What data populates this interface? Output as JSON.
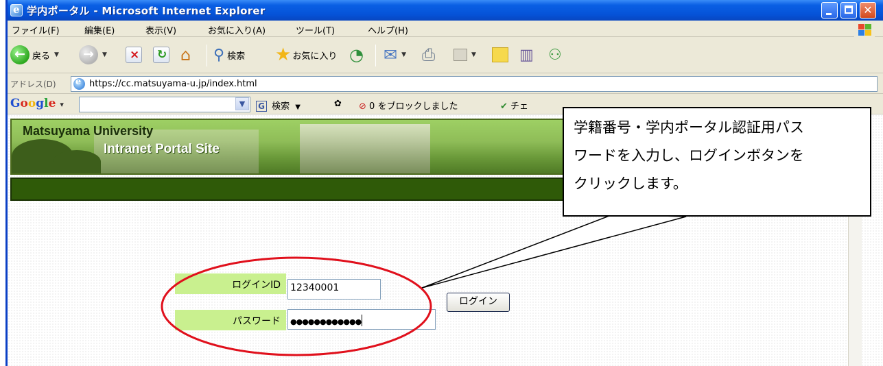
{
  "window": {
    "title": "学内ポータル - Microsoft Internet Explorer"
  },
  "menu": [
    "ファイル(F)",
    "編集(E)",
    "表示(V)",
    "お気に入り(A)",
    "ツール(T)",
    "ヘルプ(H)"
  ],
  "toolbar": {
    "back_label": "戻る",
    "search_label": "検索",
    "favorites_label": "お気に入り"
  },
  "address": {
    "label": "アドレス(D)",
    "url": "https://cc.matsuyama-u.jp/index.html"
  },
  "googlebar": {
    "logo": "Google",
    "search_label": "検索",
    "blocked_label": "0 をブロックしました",
    "check_label": "チェ"
  },
  "banner": {
    "line1": "Matsuyama University",
    "line2": "Intranet Portal Site"
  },
  "login": {
    "id_label": "ログインID",
    "id_value": "12340001",
    "password_label": "パスワード",
    "password_value": "●●●●●●●●●●●●",
    "button_label": "ログイン"
  },
  "callout": {
    "line1": "学籍番号・学内ポータル認証用パス",
    "line2": "ワードを入力し、ログインボタンを",
    "line3": "クリックします。"
  },
  "colors": {
    "titlebar": "#0553d8",
    "highlight_ellipse": "#e0101c",
    "form_label_bg": "#c9f08f",
    "banner_green": "#8fbd58",
    "dark_green_bar": "#2f5a08"
  }
}
